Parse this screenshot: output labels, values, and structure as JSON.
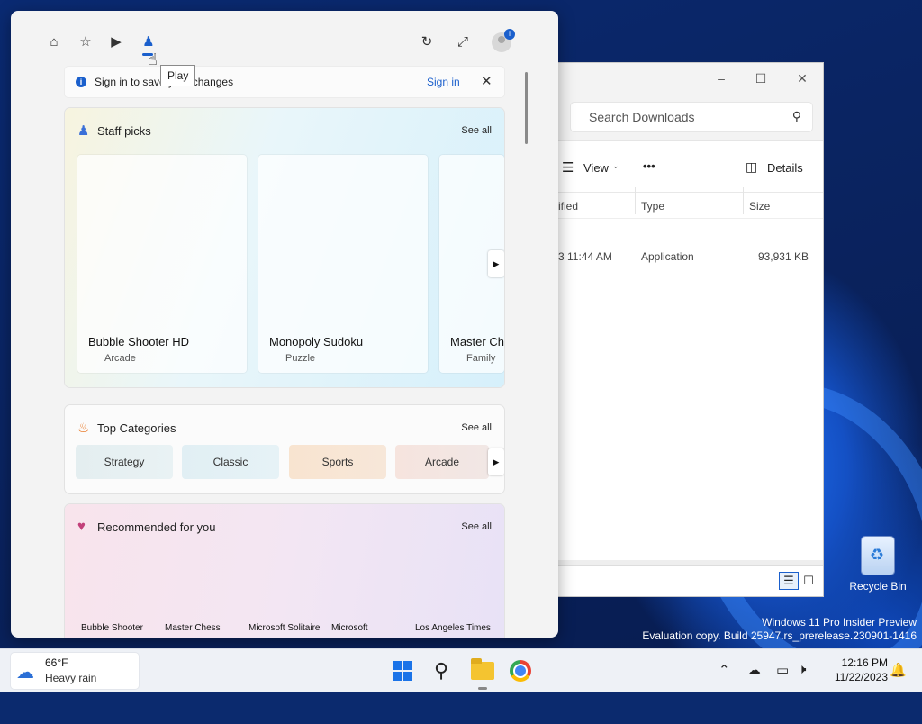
{
  "pane": {
    "tooltip": "Play",
    "banner": {
      "message": "Sign in to save your changes",
      "signin": "Sign in",
      "close": "✕"
    },
    "staff_picks": {
      "title": "Staff picks",
      "see_all": "See all",
      "tiles": [
        {
          "name": "Bubble Shooter HD",
          "category": "Arcade"
        },
        {
          "name": "Monopoly Sudoku",
          "category": "Puzzle"
        },
        {
          "name": "Master Chess",
          "category": "Family"
        }
      ]
    },
    "top_categories": {
      "title": "Top Categories",
      "see_all": "See all",
      "chips": [
        "Strategy",
        "Classic",
        "Sports",
        "Arcade"
      ]
    },
    "recommended": {
      "title": "Recommended for you",
      "see_all": "See all",
      "items": [
        "Bubble Shooter",
        "Master Chess",
        "Microsoft Solitaire",
        "Microsoft",
        "Los Angeles Times"
      ]
    }
  },
  "explorer": {
    "search_placeholder": "Search Downloads",
    "view_label": "View",
    "more_label": "•••",
    "details_label": "Details",
    "columns": [
      "ified",
      "Type",
      "Size"
    ],
    "row": {
      "modified": "3 11:44 AM",
      "type": "Application",
      "size": "93,931 KB"
    }
  },
  "desktop": {
    "recycle_bin": "Recycle Bin",
    "watermark_line1": "Windows 11 Pro Insider Preview",
    "watermark_line2": "Evaluation copy. Build 25947.rs_prerelease.230901-1416"
  },
  "taskbar": {
    "weather_temp": "66°F",
    "weather_desc": "Heavy rain",
    "time": "12:16 PM",
    "date": "11/22/2023"
  }
}
